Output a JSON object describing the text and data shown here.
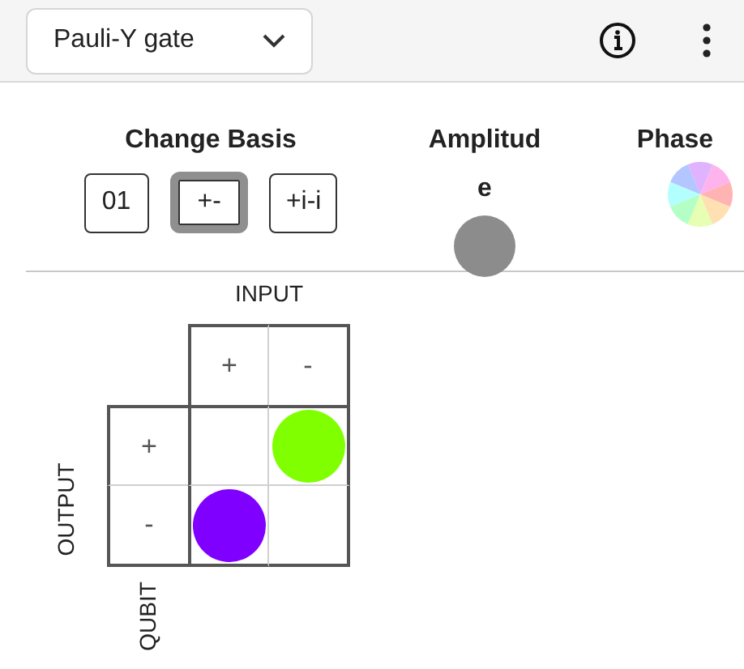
{
  "toolbar": {
    "gate_select": {
      "value": "Pauli-Y gate"
    }
  },
  "change_basis": {
    "title": "Change Basis",
    "options": [
      {
        "label": "01",
        "selected": false
      },
      {
        "label": "+-",
        "selected": true
      },
      {
        "label": "+i-i",
        "selected": false
      }
    ]
  },
  "amplitude": {
    "title_lines": [
      "Amplitud",
      "e"
    ]
  },
  "phase": {
    "title": "Phase"
  },
  "matrix": {
    "input_label": "INPUT",
    "output_label": "OUTPUT",
    "qubit_label": "QUBIT",
    "columns": [
      "+",
      "-"
    ],
    "rows": [
      {
        "label": "+",
        "cells": [
          {},
          {
            "color": "#80ff00"
          }
        ]
      },
      {
        "label": "-",
        "cells": [
          {
            "color": "#8000ff"
          },
          {}
        ]
      }
    ]
  }
}
